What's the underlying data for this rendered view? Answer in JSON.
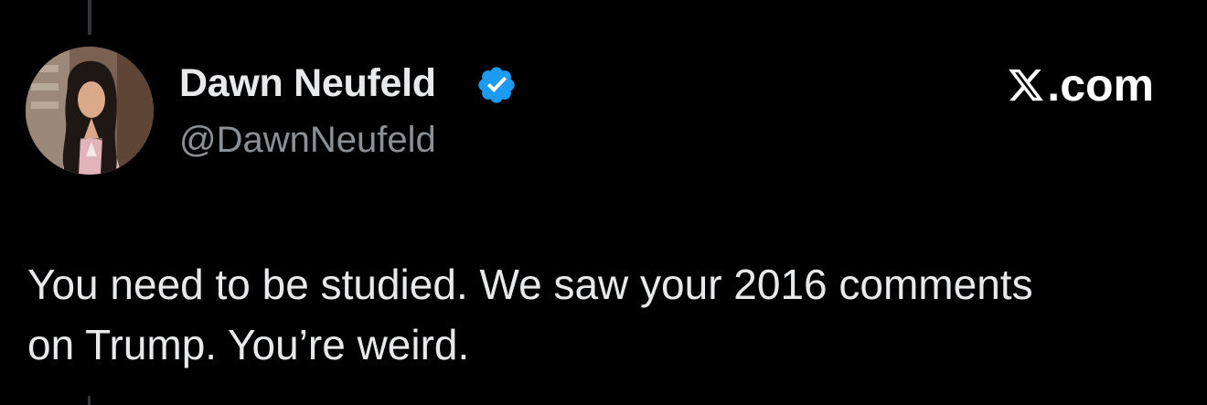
{
  "tweet": {
    "author": {
      "name": "Dawn Neufeld",
      "handle": "@DawnNeufeld",
      "verified": true,
      "avatar_icon": "profile-photo"
    },
    "brand": {
      "icon": "x-logo-icon",
      "suffix": ".com"
    },
    "text": "You need to be studied. We saw your 2016 comments on Trump. You’re weird."
  },
  "colors": {
    "background": "#000000",
    "text_primary": "#e7e9ea",
    "text_secondary": "#8b9095",
    "verified_badge": "#1d9bf0",
    "thread_line": "#333639"
  }
}
